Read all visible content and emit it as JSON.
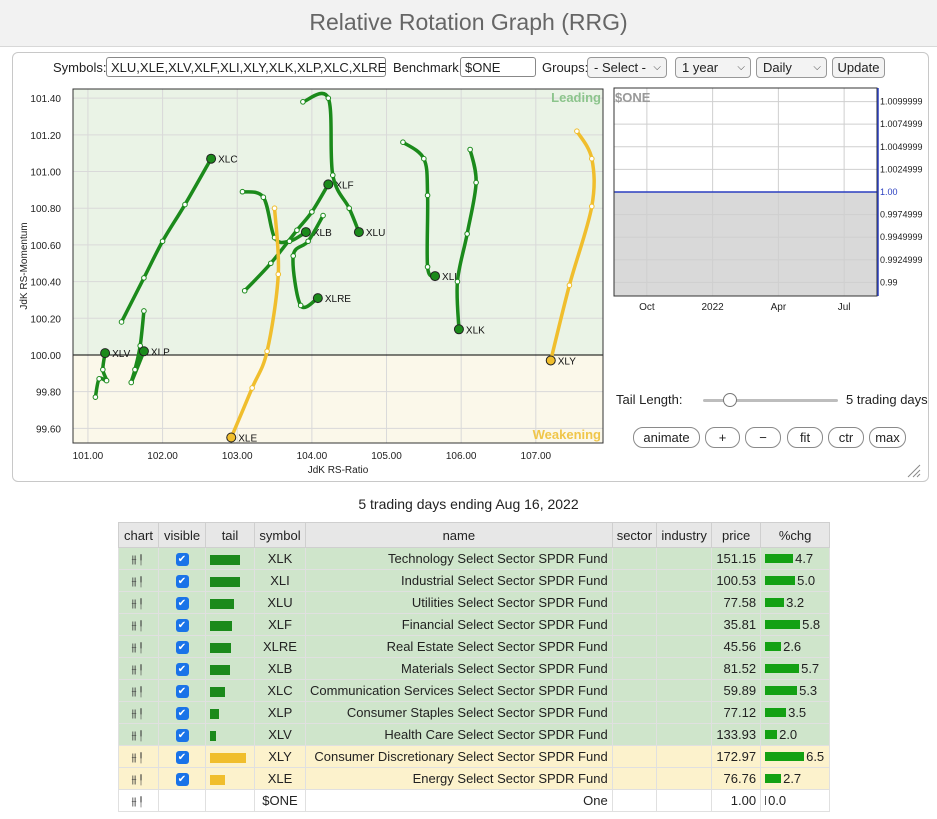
{
  "page_title": "Relative Rotation Graph (RRG)",
  "controls": {
    "symbols_label": "Symbols:",
    "symbols_value": "XLU,XLE,XLV,XLF,XLI,XLY,XLK,XLP,XLC,XLRE,XLB",
    "benchmark_label": "Benchmark:",
    "benchmark_value": "$ONE",
    "groups_label": "Groups:",
    "groups_value": "- Select -",
    "period_value": "1 year",
    "frequency_value": "Daily",
    "update_label": "Update"
  },
  "chart_data": [
    {
      "type": "scatter",
      "title": "",
      "xlabel": "JdK RS-Ratio",
      "ylabel": "JdK RS-Momentum",
      "xlim": [
        100.8,
        107.9
      ],
      "ylim": [
        99.52,
        101.45
      ],
      "xticks": [
        "101.00",
        "102.00",
        "103.00",
        "104.00",
        "105.00",
        "106.00",
        "107.00"
      ],
      "yticks": [
        "99.60",
        "99.80",
        "100.00",
        "100.20",
        "100.40",
        "100.60",
        "100.80",
        "101.00",
        "101.20",
        "101.40"
      ],
      "quadrant_labels": {
        "leading": "Leading",
        "weakening": "Weakening"
      },
      "grid": true,
      "series": [
        {
          "name": "XLC",
          "color": "#1b8a1b",
          "points": [
            [
              101.45,
              100.18
            ],
            [
              101.75,
              100.42
            ],
            [
              102.0,
              100.62
            ],
            [
              102.3,
              100.82
            ],
            [
              102.65,
              101.07
            ]
          ]
        },
        {
          "name": "XLF",
          "color": "#1b8a1b",
          "points": [
            [
              103.1,
              100.35
            ],
            [
              103.45,
              100.5
            ],
            [
              103.8,
              100.68
            ],
            [
              104.0,
              100.78
            ],
            [
              104.22,
              100.93
            ]
          ]
        },
        {
          "name": "XLU",
          "color": "#1b8a1b",
          "points": [
            [
              103.88,
              101.38
            ],
            [
              104.22,
              101.4
            ],
            [
              104.28,
              100.98
            ],
            [
              104.5,
              100.8
            ],
            [
              104.63,
              100.67
            ]
          ]
        },
        {
          "name": "XLB",
          "color": "#1b8a1b",
          "points": [
            [
              103.07,
              100.89
            ],
            [
              103.35,
              100.86
            ],
            [
              103.5,
              100.64
            ],
            [
              103.7,
              100.62
            ],
            [
              103.92,
              100.67
            ]
          ]
        },
        {
          "name": "XLRE",
          "color": "#1b8a1b",
          "points": [
            [
              104.15,
              100.76
            ],
            [
              103.95,
              100.62
            ],
            [
              103.75,
              100.54
            ],
            [
              103.85,
              100.27
            ],
            [
              104.08,
              100.31
            ]
          ]
        },
        {
          "name": "XLI",
          "color": "#1b8a1b",
          "points": [
            [
              105.22,
              101.16
            ],
            [
              105.5,
              101.07
            ],
            [
              105.55,
              100.87
            ],
            [
              105.55,
              100.48
            ],
            [
              105.65,
              100.43
            ]
          ]
        },
        {
          "name": "XLK",
          "color": "#1b8a1b",
          "points": [
            [
              106.12,
              101.12
            ],
            [
              106.2,
              100.94
            ],
            [
              106.08,
              100.66
            ],
            [
              105.95,
              100.4
            ],
            [
              105.97,
              100.14
            ]
          ]
        },
        {
          "name": "XLP",
          "color": "#1b8a1b",
          "points": [
            [
              101.75,
              100.24
            ],
            [
              101.7,
              100.05
            ],
            [
              101.63,
              99.92
            ],
            [
              101.58,
              99.85
            ],
            [
              101.75,
              100.02
            ]
          ]
        },
        {
          "name": "XLV",
          "color": "#1b8a1b",
          "points": [
            [
              101.1,
              99.77
            ],
            [
              101.15,
              99.87
            ],
            [
              101.25,
              99.86
            ],
            [
              101.2,
              99.92
            ],
            [
              101.23,
              100.01
            ]
          ]
        },
        {
          "name": "XLY",
          "color": "#f0be2d",
          "points": [
            [
              107.55,
              101.22
            ],
            [
              107.75,
              101.07
            ],
            [
              107.75,
              100.81
            ],
            [
              107.45,
              100.38
            ],
            [
              107.2,
              99.97
            ]
          ]
        },
        {
          "name": "XLE",
          "color": "#f0be2d",
          "points": [
            [
              103.5,
              100.8
            ],
            [
              103.55,
              100.44
            ],
            [
              103.4,
              100.02
            ],
            [
              103.2,
              99.82
            ],
            [
              102.92,
              99.55
            ]
          ]
        }
      ]
    },
    {
      "type": "line",
      "title": "$ONE",
      "categories": [
        "Oct",
        "2022",
        "Apr",
        "Jul"
      ],
      "yticks": [
        "1.0099999",
        "1.0074999",
        "1.0049999",
        "1.0024999",
        "1.00",
        "0.9974999",
        "0.9949999",
        "0.9924999",
        "0.99"
      ],
      "ylim": [
        0.9885,
        1.0115
      ],
      "series": [
        {
          "name": "$ONE",
          "values": [
            1.0,
            1.0,
            1.0,
            1.0,
            1.0
          ]
        }
      ]
    }
  ],
  "tail": {
    "label": "Tail Length:",
    "value_label": "5 trading days",
    "slider_fraction": 0.2
  },
  "buttons": {
    "animate": "animate",
    "plus": "+",
    "minus": "−",
    "fit": "fit",
    "ctr": "ctr",
    "max": "max"
  },
  "table": {
    "subtitle": "5 trading days ending Aug 16, 2022",
    "headers": [
      "chart",
      "visible",
      "tail",
      "symbol",
      "name",
      "sector",
      "industry",
      "price",
      "%chg"
    ],
    "rows": [
      {
        "symbol": "XLK",
        "name": "Technology Select Sector SPDR Fund",
        "price": "151.15",
        "chg": "4.7",
        "quadrant": "leading",
        "tail_level": 0.82,
        "visible": true
      },
      {
        "symbol": "XLI",
        "name": "Industrial Select Sector SPDR Fund",
        "price": "100.53",
        "chg": "5.0",
        "quadrant": "leading",
        "tail_level": 0.82,
        "visible": true
      },
      {
        "symbol": "XLU",
        "name": "Utilities Select Sector SPDR Fund",
        "price": "77.58",
        "chg": "3.2",
        "quadrant": "leading",
        "tail_level": 0.66,
        "visible": true
      },
      {
        "symbol": "XLF",
        "name": "Financial Select Sector SPDR Fund",
        "price": "35.81",
        "chg": "5.8",
        "quadrant": "leading",
        "tail_level": 0.62,
        "visible": true
      },
      {
        "symbol": "XLRE",
        "name": "Real Estate Select Sector SPDR Fund",
        "price": "45.56",
        "chg": "2.6",
        "quadrant": "leading",
        "tail_level": 0.58,
        "visible": true
      },
      {
        "symbol": "XLB",
        "name": "Materials Select Sector SPDR Fund",
        "price": "81.52",
        "chg": "5.7",
        "quadrant": "leading",
        "tail_level": 0.56,
        "visible": true
      },
      {
        "symbol": "XLC",
        "name": "Communication Services Select Sector SPDR Fund",
        "price": "59.89",
        "chg": "5.3",
        "quadrant": "leading",
        "tail_level": 0.42,
        "visible": true
      },
      {
        "symbol": "XLP",
        "name": "Consumer Staples Select Sector SPDR Fund",
        "price": "77.12",
        "chg": "3.5",
        "quadrant": "leading",
        "tail_level": 0.26,
        "visible": true
      },
      {
        "symbol": "XLV",
        "name": "Health Care Select Sector SPDR Fund",
        "price": "133.93",
        "chg": "2.0",
        "quadrant": "leading",
        "tail_level": 0.18,
        "visible": true
      },
      {
        "symbol": "XLY",
        "name": "Consumer Discretionary Select Sector SPDR Fund",
        "price": "172.97",
        "chg": "6.5",
        "quadrant": "weakening",
        "tail_level": 1.0,
        "visible": true
      },
      {
        "symbol": "XLE",
        "name": "Energy Select Sector SPDR Fund",
        "price": "76.76",
        "chg": "2.7",
        "quadrant": "weakening",
        "tail_level": 0.42,
        "visible": true
      },
      {
        "symbol": "$ONE",
        "name": "One",
        "price": "1.00",
        "chg": "0.0",
        "quadrant": "none",
        "tail_level": 0,
        "visible": false
      }
    ]
  },
  "colors": {
    "leading_bg": "#eaf3e6",
    "weakening_bg": "#fbf8ea",
    "leading_row": "#cfe5cb",
    "weakening_row": "#fcf2cc",
    "green": "#1b8a1b",
    "yellow": "#f0be2d",
    "chg_bar": "#13a113",
    "benchmark_line": "#2b3fc0"
  }
}
